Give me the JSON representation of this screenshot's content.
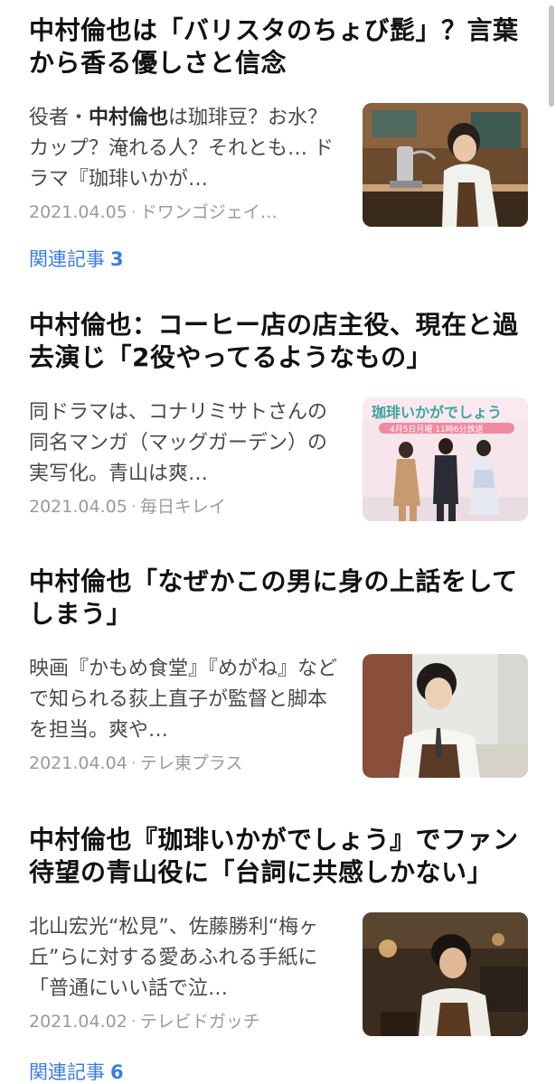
{
  "articles": [
    {
      "headline": "中村倫也は「バリスタのちょび髭」？言葉から香る優しさと信念",
      "snippet_pre": "役者・",
      "snippet_keyword": "中村倫也",
      "snippet_post": "は珈琲豆？お水？カップ？淹れる人？それとも… ドラマ『珈琲いかが…",
      "date": "2021.04.05",
      "source": "ドワンゴジェイ…",
      "thumb_icon": "barista-photo",
      "related_label": "関連記事",
      "related_count": "3"
    },
    {
      "headline": "中村倫也：コーヒー店の店主役、現在と過去演じ「2役やってるようなもの」",
      "snippet_pre": "同ドラマは、コナリミサトさんの同名マンガ（マッグガーデン）の実写化。青山は爽…",
      "snippet_keyword": "",
      "snippet_post": "",
      "date": "2021.04.05",
      "source": "毎日キレイ",
      "thumb_icon": "drama-poster-photo",
      "thumb_title": "珈琲いかがでしょう",
      "thumb_banner": "4月5日月曜 11時6分放送",
      "related_label": "",
      "related_count": ""
    },
    {
      "headline": "中村倫也「なぜかこの男に身の上話をしてしまう」",
      "snippet_pre": "映画『かもめ食堂』『めがね』などで知られる荻上直子が監督と脚本を担当。爽や…",
      "snippet_keyword": "",
      "snippet_post": "",
      "date": "2021.04.04",
      "source": "テレ東プラス",
      "thumb_icon": "actor-portrait-photo",
      "related_label": "",
      "related_count": ""
    },
    {
      "headline": "中村倫也『珈琲いかがでしょう』でファン待望の青山役に「台詞に共感しかない」",
      "snippet_pre": "北山宏光“松見”、佐藤勝利“梅ヶ丘”らに対する愛あふれる手紙に「普通にいい話で泣…",
      "snippet_keyword": "",
      "snippet_post": "",
      "date": "2021.04.02",
      "source": "テレビドガッチ",
      "thumb_icon": "cafe-scene-photo",
      "related_label": "関連記事",
      "related_count": "6"
    }
  ],
  "colors": {
    "link": "#3b7de0",
    "meta": "#9a9a9a",
    "snippet": "#4a4a4a",
    "headline": "#111111"
  }
}
